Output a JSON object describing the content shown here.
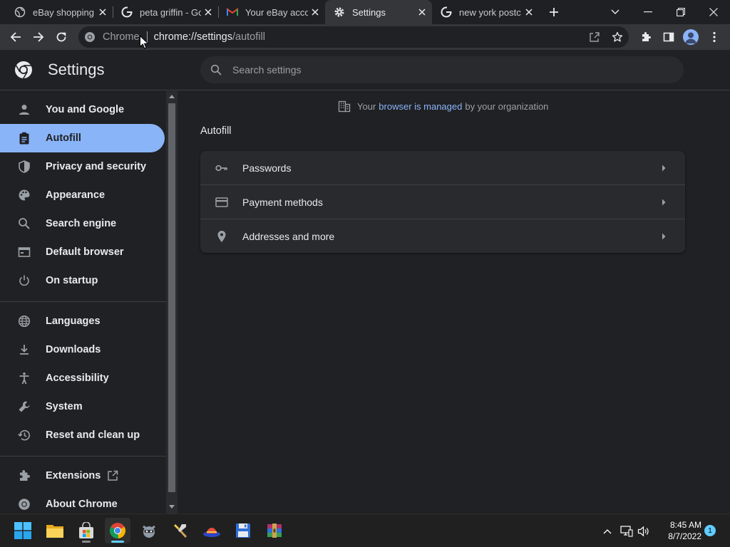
{
  "tabs": [
    {
      "title": "eBay shopping c",
      "favicon": "globe-icon"
    },
    {
      "title": "peta griffin - Go",
      "favicon": "google-icon"
    },
    {
      "title": "Your eBay accou",
      "favicon": "gmail-icon"
    },
    {
      "title": "Settings",
      "favicon": "gear-icon",
      "active": true
    },
    {
      "title": "new york postc",
      "favicon": "google-icon"
    }
  ],
  "omnibox": {
    "site_label": "Chrome",
    "url_host": "chrome://settings",
    "url_path": "/autofill"
  },
  "settings": {
    "title": "Settings",
    "search_placeholder": "Search settings"
  },
  "sidebar": {
    "items": [
      {
        "label": "You and Google",
        "icon": "person-icon"
      },
      {
        "label": "Autofill",
        "icon": "clipboard-icon",
        "active": true
      },
      {
        "label": "Privacy and security",
        "icon": "shield-icon"
      },
      {
        "label": "Appearance",
        "icon": "palette-icon"
      },
      {
        "label": "Search engine",
        "icon": "search-icon"
      },
      {
        "label": "Default browser",
        "icon": "browser-icon"
      },
      {
        "label": "On startup",
        "icon": "power-icon"
      },
      {
        "label": "Languages",
        "icon": "globe-icon"
      },
      {
        "label": "Downloads",
        "icon": "download-icon"
      },
      {
        "label": "Accessibility",
        "icon": "accessibility-icon"
      },
      {
        "label": "System",
        "icon": "wrench-icon"
      },
      {
        "label": "Reset and clean up",
        "icon": "history-icon"
      },
      {
        "label": "Extensions",
        "icon": "puzzle-icon"
      },
      {
        "label": "About Chrome",
        "icon": "chrome-icon"
      }
    ]
  },
  "managed": {
    "prefix": "Your",
    "link": "browser is managed",
    "suffix": "by your organization"
  },
  "main": {
    "section_title": "Autofill",
    "rows": [
      {
        "label": "Passwords",
        "icon": "key-icon"
      },
      {
        "label": "Payment methods",
        "icon": "credit-card-icon"
      },
      {
        "label": "Addresses and more",
        "icon": "location-pin-icon"
      }
    ]
  },
  "taskbar": {
    "time": "8:45 AM",
    "date": "8/7/2022",
    "notification_count": "1"
  },
  "colors": {
    "accent": "#8ab4f8",
    "background": "#202124",
    "card": "#292a2d"
  }
}
